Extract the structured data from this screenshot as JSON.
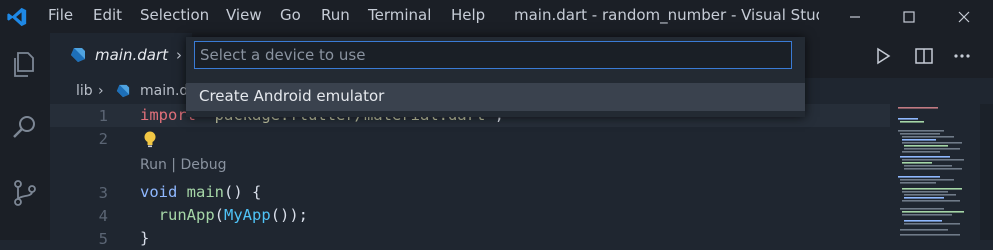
{
  "menubar": {
    "items": [
      "File",
      "Edit",
      "Selection",
      "View",
      "Go",
      "Run",
      "Terminal",
      "Help"
    ]
  },
  "window": {
    "title": "main.dart - random_number - Visual Studio ..."
  },
  "tab": {
    "label": "main.dart",
    "chevron": "›"
  },
  "breadcrumb": {
    "folder": "lib",
    "sep": "›",
    "file": "main.d"
  },
  "quick_pick": {
    "placeholder": "Select a device to use",
    "value": "",
    "items": [
      "Create Android emulator"
    ]
  },
  "editor": {
    "lines": [
      {
        "n": "1",
        "pre": "import ",
        "str": "'package:flutter/material.dart'",
        "post": ";"
      },
      {
        "n": "2"
      },
      {
        "n": "3",
        "kw": "void",
        "fn": "main",
        "rest": "() {"
      },
      {
        "n": "4",
        "call": "runApp",
        "open": "(",
        "cls": "MyApp",
        "close": "());"
      },
      {
        "n": "5",
        "brace": "}"
      }
    ],
    "codelens": "Run | Debug"
  },
  "icons": {
    "app": "vscode-logo-icon",
    "explorer": "files-icon",
    "search": "search-icon",
    "scm": "source-control-icon",
    "run": "run-icon",
    "split": "split-editor-icon",
    "more": "more-actions-icon",
    "dart": "dart-icon",
    "lightbulb": "lightbulb-icon"
  },
  "colors": {
    "accent": "#3a7bd5",
    "keyword_import": "#e0707a",
    "keyword": "#8fb8ff",
    "function": "#a5d6a7",
    "class": "#4fc3f7",
    "string": "#c5c8a6"
  }
}
